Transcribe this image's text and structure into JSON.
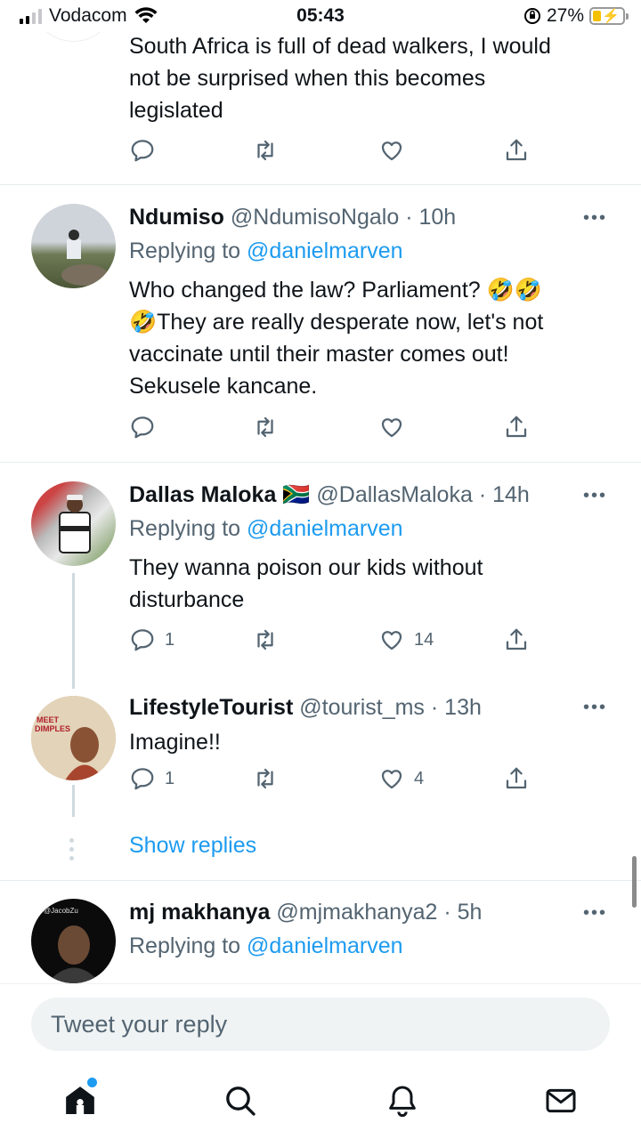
{
  "status_bar": {
    "carrier": "Vodacom",
    "time": "05:43",
    "battery": "27%",
    "battery_level": 0.27
  },
  "top_tweet": {
    "text_lines": [
      "South Africa is full of dead walkers, I would",
      "not be surprised when this becomes",
      "legislated"
    ]
  },
  "tweets": [
    {
      "name": "Ndumiso",
      "handle": "@NdumisoNgalo",
      "time": "· 10h",
      "replying_prefix": "Replying to",
      "replying_to": "@danielmarven",
      "text_lines": [
        "Who changed the law? Parliament? 🤣🤣",
        "🤣They are really desperate now, let's not",
        "vaccinate until their master comes out!",
        "Sekusele kancane."
      ],
      "reply_count": "",
      "like_count": ""
    },
    {
      "name": "Dallas Maloka",
      "flag": "🇿🇦",
      "handle": "@DallasMaloka",
      "time": "· 14h",
      "replying_prefix": "Replying to",
      "replying_to": "@danielmarven",
      "text_lines": [
        "They wanna poison our kids without",
        "disturbance"
      ],
      "reply_count": "1",
      "like_count": "14"
    },
    {
      "name": "LifestyleTourist",
      "handle": "@tourist_ms",
      "time": "· 13h",
      "text_lines": [
        "Imagine!!"
      ],
      "reply_count": "1",
      "like_count": "4"
    },
    {
      "name": "mj makhanya",
      "handle": "@mjmakhanya2",
      "time": "· 5h",
      "replying_prefix": "Replying to",
      "replying_to": "@danielmarven",
      "avatar_label": "@JacobZu"
    }
  ],
  "show_replies": "Show replies",
  "composer": {
    "placeholder": "Tweet your reply"
  },
  "nav": [
    "home-icon",
    "search-icon",
    "notifications-icon",
    "messages-icon"
  ],
  "colors": {
    "link": "#1d9bf0",
    "muted": "#536471",
    "text": "#0f1419"
  }
}
